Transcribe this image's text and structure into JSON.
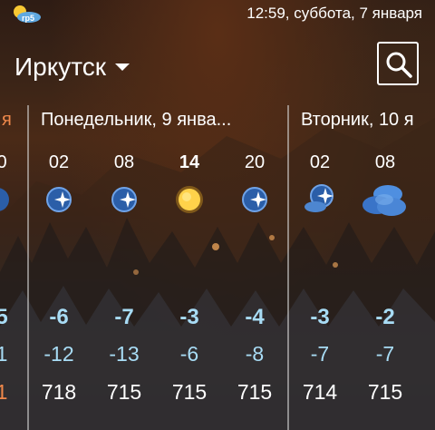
{
  "status": {
    "time": "12:59, суббота, 7 января"
  },
  "header": {
    "city": "Иркутск"
  },
  "prev_day": {
    "title_fragment": "я",
    "hour_fragment": "0",
    "max_fragment": "5",
    "min_fragment": "1",
    "press_fragment": "1"
  },
  "days": [
    {
      "title": "Понедельник, 9 янва...",
      "slots": [
        {
          "hour": "02",
          "icon": "clear-night-icon",
          "max": "-6",
          "min": "-12",
          "pressure": "718"
        },
        {
          "hour": "08",
          "icon": "clear-night-icon",
          "max": "-7",
          "min": "-13",
          "pressure": "715"
        },
        {
          "hour": "14",
          "icon": "sun-icon",
          "max": "-3",
          "min": "-6",
          "pressure": "715"
        },
        {
          "hour": "20",
          "icon": "clear-night-icon",
          "max": "-4",
          "min": "-8",
          "pressure": "715"
        }
      ]
    },
    {
      "title": "Вторник, 10 я",
      "slots": [
        {
          "hour": "02",
          "icon": "partly-cloudy-night-icon",
          "max": "-3",
          "min": "-7",
          "pressure": "714"
        },
        {
          "hour": "08",
          "icon": "cloudy-icon",
          "max": "-2",
          "min": "-7",
          "pressure": "715"
        }
      ]
    }
  ],
  "colors": {
    "temperature": "#a8dcf5",
    "prev_day_accent": "#f0884a",
    "divider": "#dcdcdc"
  }
}
